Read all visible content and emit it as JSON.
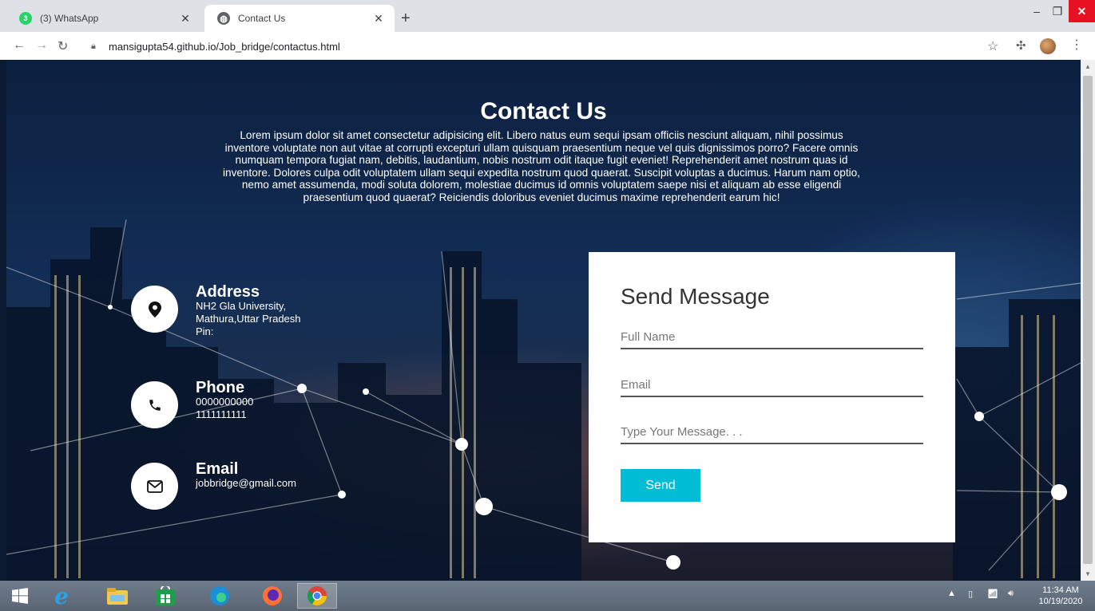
{
  "browser": {
    "tabs": [
      {
        "title": "(3) WhatsApp",
        "badge": "3"
      },
      {
        "title": "Contact Us"
      }
    ],
    "url": "mansigupta54.github.io/Job_bridge/contactus.html"
  },
  "page": {
    "title": "Contact Us",
    "intro": "Lorem ipsum dolor sit amet consectetur adipisicing elit. Libero natus eum sequi ipsam officiis nesciunt aliquam, nihil possimus inventore voluptate non aut vitae at corrupti excepturi ullam quisquam praesentium neque vel quis dignissimos porro? Facere omnis numquam tempora fugiat nam, debitis, laudantium, nobis nostrum odit itaque fugit eveniet! Reprehenderit amet nostrum quas id inventore. Dolores culpa odit voluptatem ullam sequi expedita nostrum quod quaerat. Suscipit voluptas a ducimus. Harum nam optio, nemo amet assumenda, modi soluta dolorem, molestiae ducimus id omnis voluptatem saepe nisi et aliquam ab esse eligendi praesentium quod quaerat? Reiciendis doloribus eveniet ducimus maxime reprehenderit earum hic!",
    "address": {
      "label": "Address",
      "lines": [
        "NH2 Gla University,",
        "Mathura,Uttar Pradesh",
        "Pin:"
      ]
    },
    "phone": {
      "label": "Phone",
      "lines": [
        "0000000000",
        "1111111111"
      ]
    },
    "email": {
      "label": "Email",
      "value": "jobbridge@gmail.com"
    },
    "form": {
      "heading": "Send Message",
      "full_name_placeholder": "Full Name",
      "email_placeholder": "Email",
      "message_placeholder": "Type Your Message. . .",
      "send_label": "Send"
    }
  },
  "taskbar": {
    "clock_time": "11:34 AM",
    "clock_date": "10/19/2020"
  }
}
